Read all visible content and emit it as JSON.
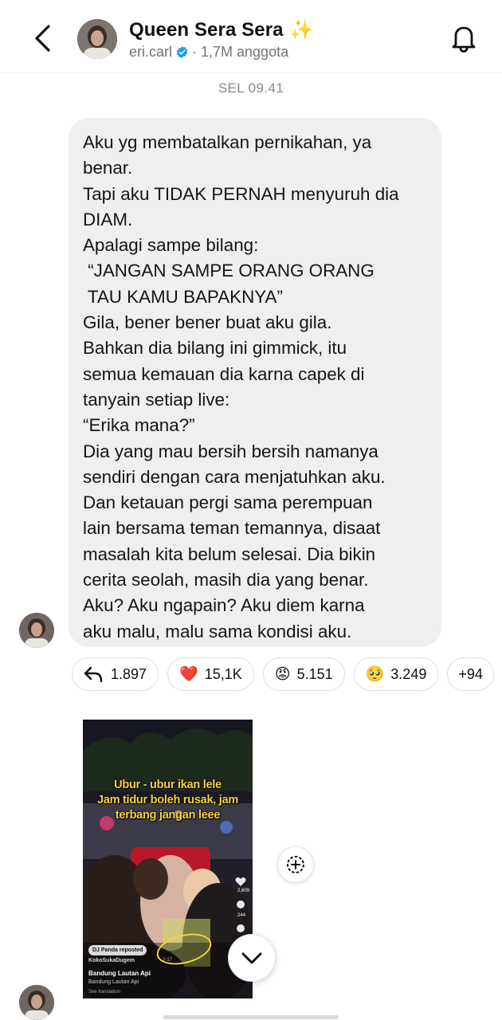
{
  "header": {
    "channel_name": "Queen Sera Sera",
    "title_emoji": "✨",
    "handle": "eri.carl",
    "members": "· 1,7M anggota",
    "icons": {
      "back": "back-arrow-icon",
      "notifications": "bell-icon",
      "verified": "verified-badge-icon"
    }
  },
  "timestamp": "SEL 09.41",
  "message": {
    "lines": [
      "Aku yg membatalkan pernikahan, ya",
      "benar.",
      "Tapi aku TIDAK PERNAH menyuruh dia",
      "DIAM.",
      "Apalagi sampe bilang:",
      " “JANGAN SAMPE ORANG ORANG",
      " TAU KAMU BAPAKNYA”",
      "Gila, bener bener buat aku gila.",
      "Bahkan dia bilang ini gimmick, itu",
      "semua kemauan dia karna capek di",
      "tanyain setiap live:",
      "“Erika mana?”",
      "Dia yang mau bersih bersih namanya",
      "sendiri dengan cara menjatuhkan aku.",
      "Dan ketauan pergi sama perempuan",
      "lain bersama teman temannya, disaat",
      "masalah kita belum selesai. Dia bikin",
      "cerita seolah, masih dia yang benar.",
      "Aku? Aku ngapain? Aku diem karna",
      "aku malu, malu sama kondisi aku."
    ]
  },
  "reactions": {
    "reply_count": "1.897",
    "heart_emoji": "❤️",
    "heart_count": "15,1K",
    "angry_emoji": "😡",
    "angry_count": "5.151",
    "pleading_emoji": "🥺",
    "pleading_count": "3.249",
    "more": "+94"
  },
  "media": {
    "caption_lines": [
      "Ubur - ubur ikan lele",
      "Jam tidur boleh rusak, jam",
      "terbang jangan leee"
    ],
    "likes": "2,609",
    "comments": "244",
    "reposted": "DJ Panda reposted",
    "author": "KokoSukaDugem",
    "date": "2-17",
    "title": "Bandung Lautan Api",
    "sound": "Bandung Lautan Api",
    "translation": "See translation"
  }
}
